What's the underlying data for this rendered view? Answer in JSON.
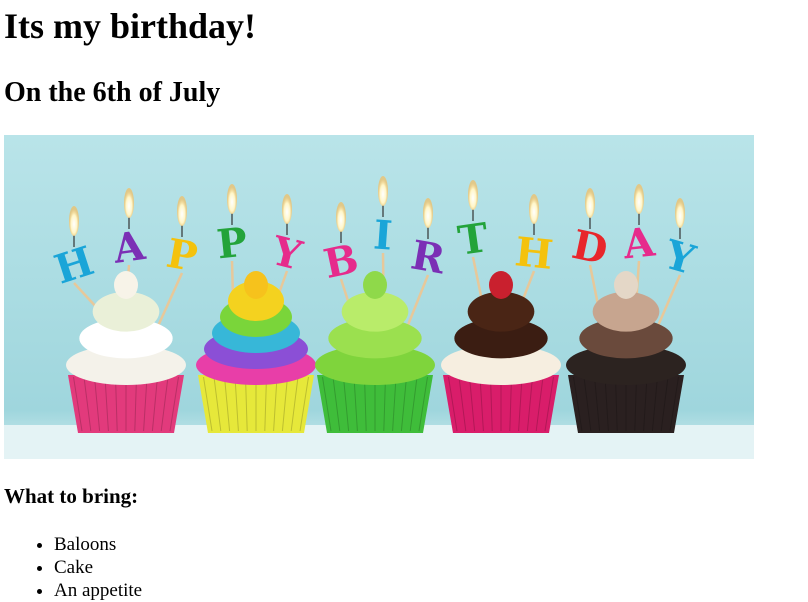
{
  "page": {
    "title": "Its my birthday!",
    "subtitle": "On the 6th of July",
    "banner": {
      "icon": "birthday-cupcakes-photo",
      "candle_letters": [
        "H",
        "A",
        "P",
        "P",
        "Y",
        "B",
        "I",
        "R",
        "T",
        "H",
        "D",
        "A",
        "Y"
      ],
      "letter_colors": [
        "#1aa5d8",
        "#7b2fb5",
        "#f4c20d",
        "#23a33a",
        "#e62b8c",
        "#e62b8c",
        "#1aa5d8",
        "#7b2fb5",
        "#23a33a",
        "#f4c20d",
        "#e8262b",
        "#e62b8c",
        "#1aa5d8"
      ],
      "background_color": "#a9dde3"
    },
    "bring_heading": "What to bring:",
    "bring_items": [
      "Baloons",
      "Cake",
      "An appetite"
    ]
  }
}
